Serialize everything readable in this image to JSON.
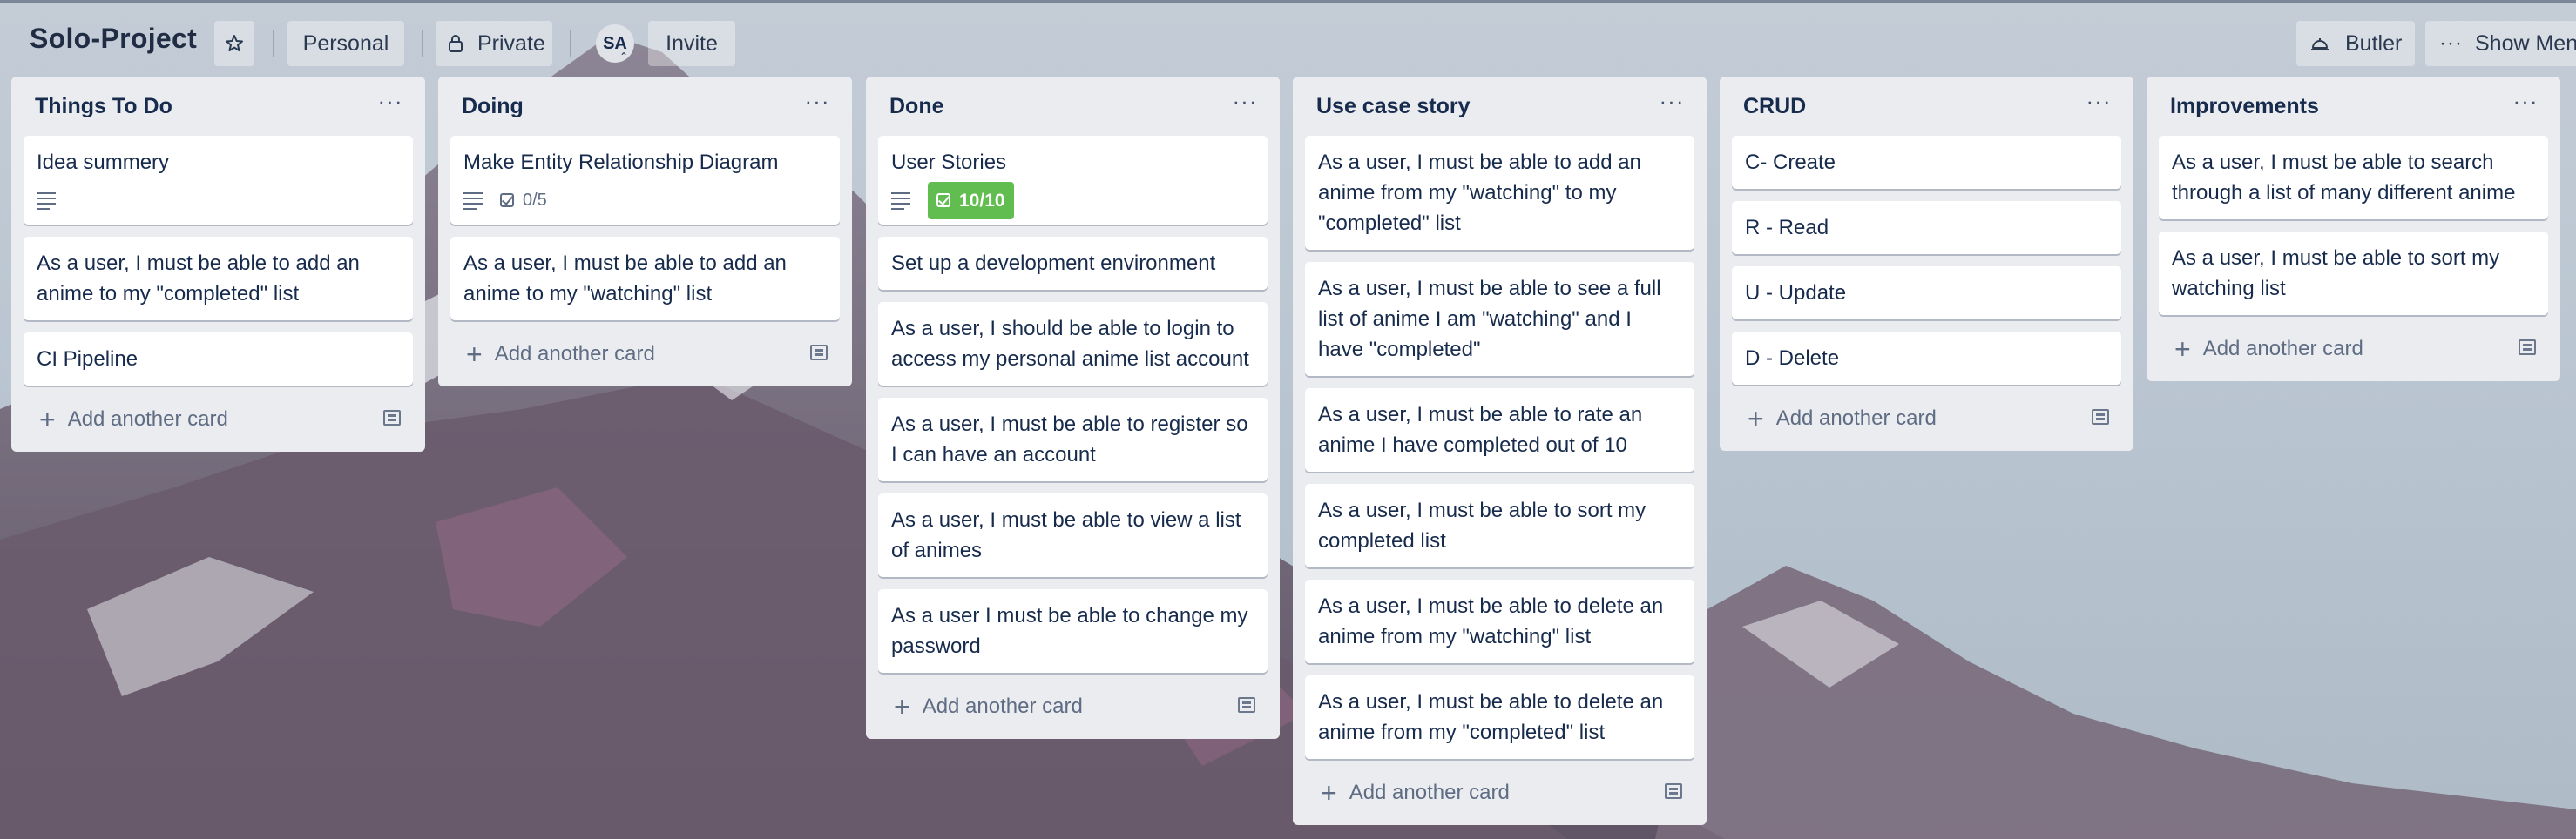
{
  "board": {
    "title": "Solo-Project",
    "workspace": "Personal",
    "visibility": "Private",
    "member_initials": "SA",
    "invite_label": "Invite",
    "butler_label": "Butler",
    "show_menu_label": "Show Menu"
  },
  "lists": [
    {
      "title": "Things To Do",
      "cards": [
        {
          "text": "Idea summery",
          "description": true
        },
        {
          "text": "As a user, I must be able to add an anime to my \"completed\" list"
        },
        {
          "text": "CI Pipeline"
        }
      ],
      "add_label": "Add another card"
    },
    {
      "title": "Doing",
      "cards": [
        {
          "text": "Make Entity Relationship Diagram",
          "description": true,
          "checklist": "0/5"
        },
        {
          "text": "As a user, I must be able to add an anime to my \"watching\" list"
        }
      ],
      "add_label": "Add another card"
    },
    {
      "title": "Done",
      "cards": [
        {
          "text": "User Stories",
          "description": true,
          "checklist": "10/10",
          "checklist_complete": true
        },
        {
          "text": "Set up a development environment"
        },
        {
          "text": "As a user, I should be able to login to access my personal anime list account"
        },
        {
          "text": "As a user, I must be able to register so I can have an account"
        },
        {
          "text": "As a user, I must be able to view a list of animes"
        },
        {
          "text": "As a user I must be able to change my password"
        }
      ],
      "add_label": "Add another card"
    },
    {
      "title": "Use case story",
      "cards": [
        {
          "text": "As a user, I must be able to add an anime from my \"watching\" to my \"completed\" list"
        },
        {
          "text": "As a user, I must be able to see a full list of anime I am \"watching\" and I have \"completed\""
        },
        {
          "text": "As a user, I must be able to rate an anime I have completed out of 10"
        },
        {
          "text": "As a user, I must be able to sort my completed list"
        },
        {
          "text": "As a user, I must be able to delete an anime from my \"watching\" list"
        },
        {
          "text": "As a user, I must be able to delete an anime from my \"completed\" list"
        }
      ],
      "add_label": "Add another card"
    },
    {
      "title": "CRUD",
      "cards": [
        {
          "text": "C- Create"
        },
        {
          "text": "R - Read"
        },
        {
          "text": "U - Update"
        },
        {
          "text": "D - Delete"
        }
      ],
      "add_label": "Add another card"
    },
    {
      "title": "Improvements",
      "cards": [
        {
          "text": "As a user, I must be able to search through a list of many different anime"
        },
        {
          "text": "As a user, I must be able to sort my watching list"
        }
      ],
      "add_label": "Add another card"
    }
  ],
  "colors": {
    "list_bg": "#ebecf0",
    "card_bg": "#ffffff",
    "text": "#172b4d",
    "checklist_complete": "#61bd4f"
  },
  "icons": {
    "star": "star-icon",
    "lock": "lock-icon",
    "butler": "butler-icon",
    "more": "more-horizontal-icon",
    "plus": "plus-icon",
    "template": "card-template-icon",
    "description": "description-icon",
    "checklist": "checklist-icon"
  }
}
